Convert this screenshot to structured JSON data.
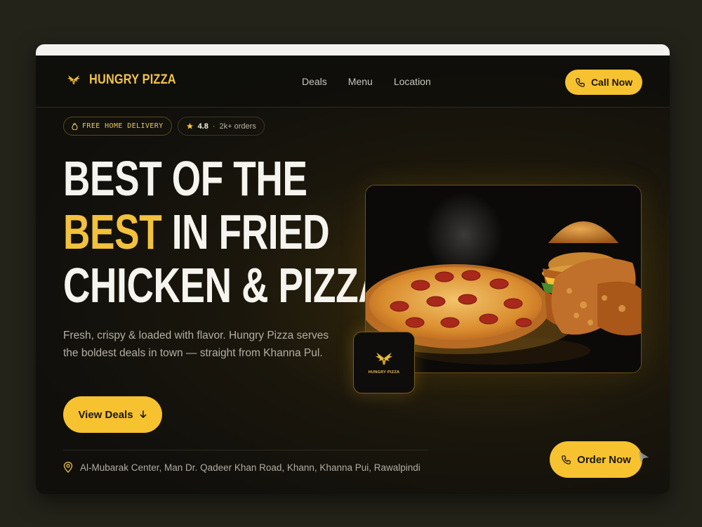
{
  "brand": {
    "name": "HUNGRY PIZZA",
    "logo_icon": "eagle-wings-icon"
  },
  "nav": {
    "links": [
      {
        "label": "Deals"
      },
      {
        "label": "Menu"
      },
      {
        "label": "Location"
      }
    ],
    "call_button": {
      "label": "Call Now",
      "icon": "phone-icon"
    }
  },
  "badges": {
    "delivery": {
      "label": "FREE HOME DELIVERY",
      "icon": "fire-icon"
    },
    "rating": {
      "value": "4.8",
      "separator": "·",
      "orders": "2k+ orders",
      "icon": "star-icon"
    }
  },
  "hero": {
    "headline_line1": "BEST OF THE",
    "headline_line2_highlight": "BEST",
    "headline_line2_rest": " IN FRIED",
    "headline_line3": "CHICKEN & PIZZA",
    "description": "Fresh, crispy & loaded with flavor. Hungry Pizza serves the boldest deals in town — straight from Khanna Pul.",
    "cta": {
      "label": "View Deals",
      "icon": "arrow-down-icon"
    }
  },
  "logo_card": {
    "text": "HUNGRY PIZZA"
  },
  "footer": {
    "address": "Al-Mubarak Center, Man Dr. Qadeer Khan Road, Khann, Khanna Pui, Rawalpindi",
    "address_icon": "location-pin-icon"
  },
  "order_button": {
    "label": "Order Now",
    "icon": "phone-icon"
  },
  "colors": {
    "accent": "#f6c230",
    "gold_text": "#f2c13d",
    "background": "#100f0c",
    "outer_background": "#23231a"
  }
}
